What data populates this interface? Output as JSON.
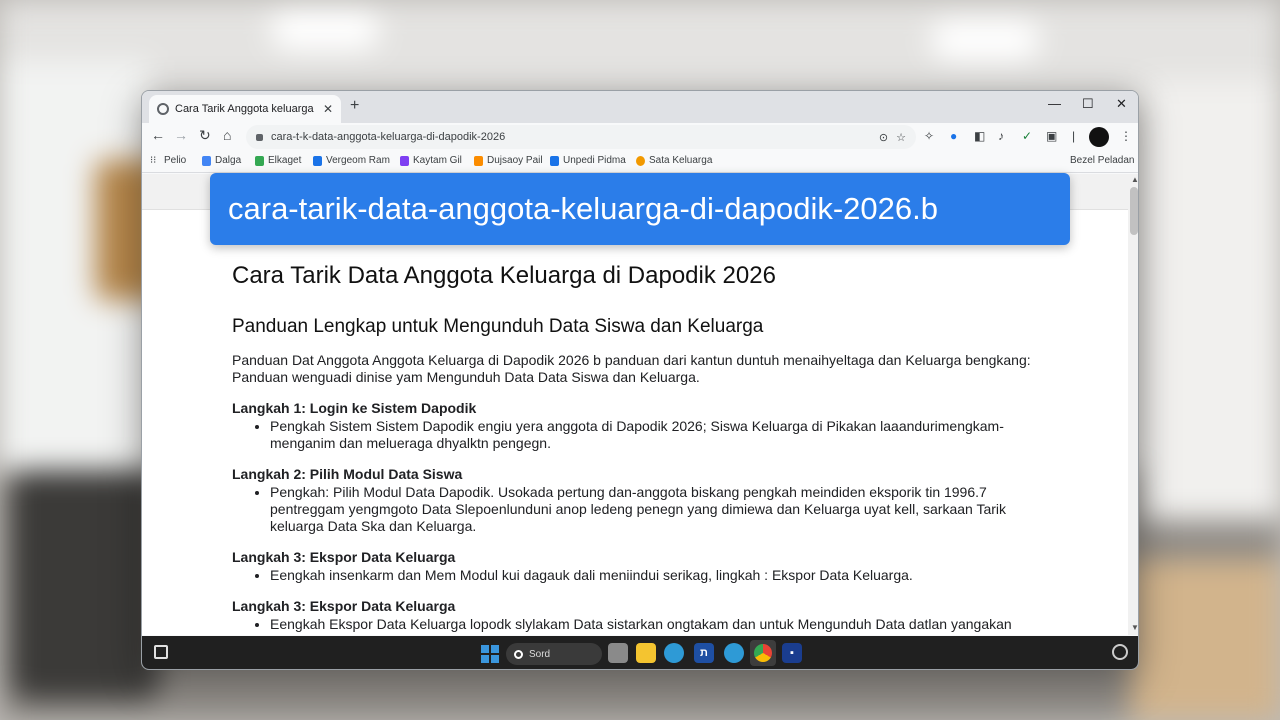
{
  "banner": {
    "text": "cara-tarik-data-anggota-keluarga-di-dapodik-2026.b"
  },
  "browser": {
    "tab_title": "Cara Tarik Anggota keluarga",
    "url": "cara-t-k-data-anggota-keluarga-di-dapodik-2026",
    "bookmarks": [
      {
        "label": "Pelio",
        "color": "#ea4335"
      },
      {
        "label": "Dalga",
        "color": "#4285f4"
      },
      {
        "label": "Elkaget",
        "color": "#34a853"
      },
      {
        "label": "Vergeom Ram",
        "color": "#1a73e8"
      },
      {
        "label": "Kaytam Gil",
        "color": "#7e3ff2"
      },
      {
        "label": "Dujsaoy Pail",
        "color": "#fb8c00"
      },
      {
        "label": "Unpedi Pidma",
        "color": "#1a73e8"
      },
      {
        "label": "Sata Keluarga",
        "color": "#f29900"
      }
    ],
    "bookmarks_right": "Bezel Peladan"
  },
  "article": {
    "title": "Cara Tarik Data Anggota Keluarga di Dapodik 2026",
    "subtitle": "Panduan Lengkap untuk Mengunduh Data Siswa dan Keluarga",
    "intro": "Panduan Dat Anggota Anggota Keluarga di Dapodik 2026 b panduan dari kantun duntuh menaihyeltaga dan Keluarga bengkang: Panduan wenguadi dinise yam Mengunduh Data Data Siswa dan Keluarga.",
    "steps": [
      {
        "heading": "Langkah 1: Login ke Sistem Dapodik",
        "bullet": "Pengkah Sistem Sistem Dapodik engiu yera anggota di Dapodik 2026; Siswa Keluarga di Pikakan laaandurimengkam-menganim dan melueraga dhyalktn pengegn."
      },
      {
        "heading": "Langkah 2: Pilih Modul Data Siswa",
        "bullet": "Pengkah: Pilih Modul Data Dapodik. Usokada pertung dan-anggota biskang pengkah meindiden eksporik tin 1996.7 pentreggam yengmgoto Data Slepoenlunduni anop ledeng penegn yang dimiewa dan Keluarga uyat kell, sarkaan Tarik keluarga Data Ska dan Keluarga."
      },
      {
        "heading": "Langkah 3: Ekspor Data Keluarga",
        "bullet": "Eengkah insenkarm dan Mem Modul kui dagauk dali meniindui serikag, lingkah : Ekspor Data Keluarga."
      },
      {
        "heading": "Langkah 3: Ekspor Data Keluarga",
        "bullet": "Eengkah Ekspor Data Keluarga lopodk slylakam Data sistarkan ongtakam dan untuk Mengunduh Data datlan yangakan"
      }
    ]
  },
  "taskbar": {
    "search_text": "Sord"
  },
  "colors": {
    "banner": "#2b7de9",
    "taskbar": "#202020",
    "chrome": "#dfe1e5"
  }
}
